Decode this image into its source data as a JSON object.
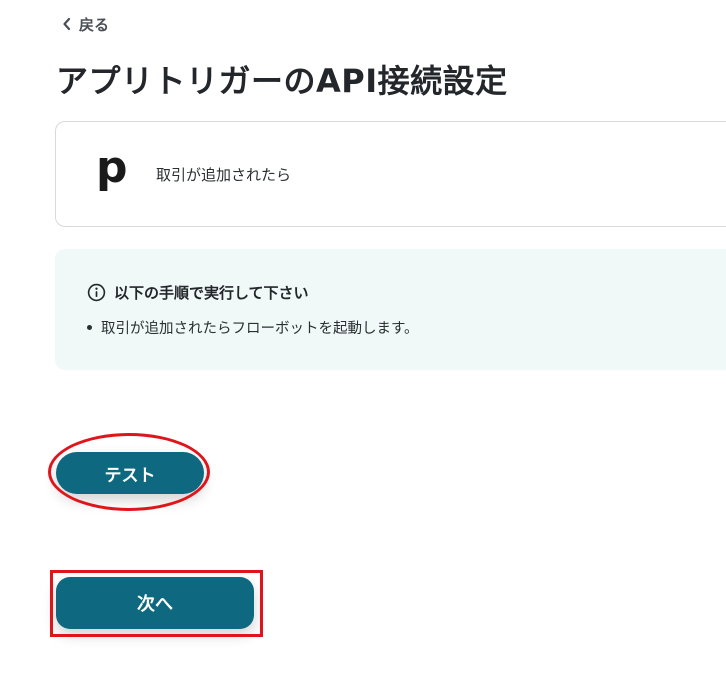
{
  "nav": {
    "back_label": "戻る"
  },
  "page": {
    "title": "アプリトリガーのAPI接続設定"
  },
  "app_card": {
    "logo_letter": "p",
    "trigger_label": "取引が追加されたら"
  },
  "instructions": {
    "heading": "以下の手順で実行して下さい",
    "items": [
      "取引が追加されたらフローボットを起動します。"
    ]
  },
  "buttons": {
    "test_label": "テスト",
    "next_label": "次へ"
  },
  "colors": {
    "primary": "#0d6880",
    "annotation_red": "#e0151b",
    "info_bg": "#f1f8f8"
  }
}
